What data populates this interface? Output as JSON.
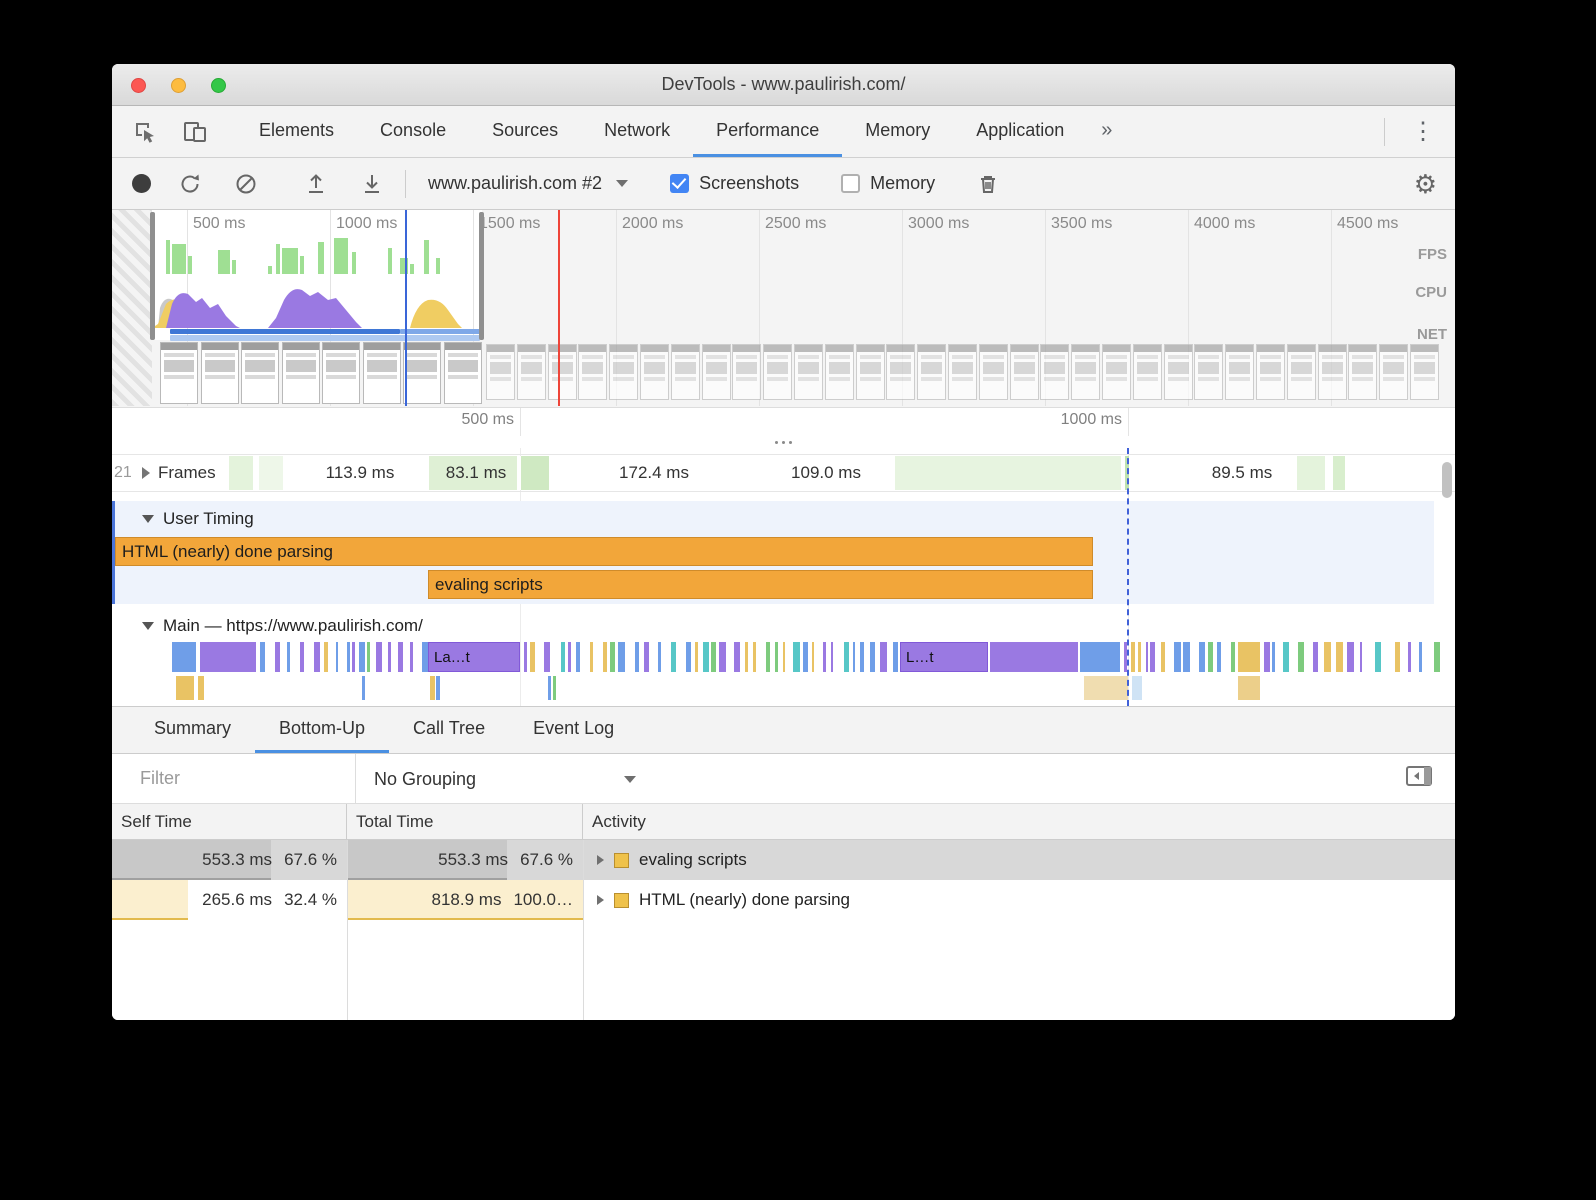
{
  "window": {
    "title": "DevTools - www.paulirish.com/"
  },
  "tabs": {
    "items": [
      "Elements",
      "Console",
      "Sources",
      "Network",
      "Performance",
      "Memory",
      "Application"
    ],
    "active": "Performance",
    "overflow_label": "»"
  },
  "toolbar": {
    "profile_label": "www.paulirish.com #2",
    "screenshots": {
      "label": "Screenshots",
      "checked": true
    },
    "memory": {
      "label": "Memory",
      "checked": false
    }
  },
  "overview": {
    "time_labels": [
      "500 ms",
      "1000 ms",
      "1500 ms",
      "2000 ms",
      "2500 ms",
      "3000 ms",
      "3500 ms",
      "4000 ms",
      "4500 ms"
    ],
    "lanes": [
      "FPS",
      "CPU",
      "NET"
    ]
  },
  "ruler": {
    "ticks": [
      "500 ms",
      "1000 ms"
    ]
  },
  "flame": {
    "frames_label": "Frames",
    "frames_clipped_text": "21",
    "frame_durations": [
      "113.9 ms",
      "83.1 ms",
      "172.4 ms",
      "109.0 ms",
      "89.5 ms"
    ],
    "user_timing_label": "User Timing",
    "user_timing_bars": [
      "HTML (nearly) done parsing",
      "evaling scripts"
    ],
    "main_label": "Main — https://www.paulirish.com/",
    "main_chips": [
      "La…t",
      "L…t"
    ]
  },
  "bottom": {
    "tabs": [
      "Summary",
      "Bottom-Up",
      "Call Tree",
      "Event Log"
    ],
    "active_tab": "Bottom-Up",
    "filter_placeholder": "Filter",
    "grouping_value": "No Grouping",
    "table": {
      "columns": [
        "Self Time",
        "Total Time",
        "Activity"
      ],
      "rows": [
        {
          "self_time": "553.3 ms",
          "self_pct": "67.6 %",
          "self_pct_value": 67.6,
          "total_time": "553.3 ms",
          "total_pct": "67.6 %",
          "total_pct_value": 67.6,
          "activity": "evaling scripts",
          "selected": true
        },
        {
          "self_time": "265.6 ms",
          "self_pct": "32.4 %",
          "self_pct_value": 32.4,
          "total_time": "818.9 ms",
          "total_pct": "100.0…",
          "total_pct_value": 100,
          "activity": "HTML (nearly) done parsing",
          "selected": false
        }
      ]
    }
  }
}
